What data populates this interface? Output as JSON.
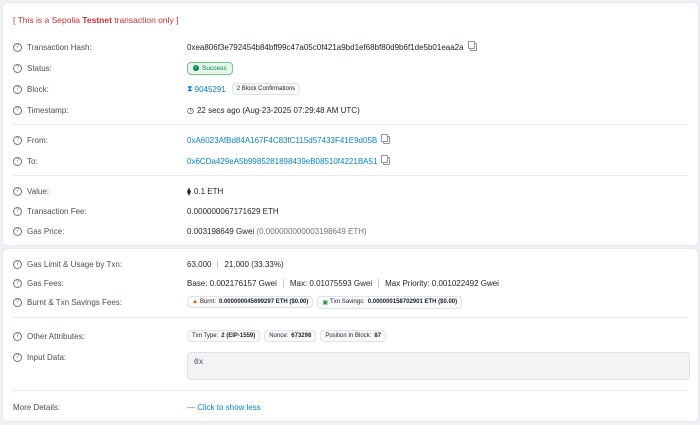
{
  "notice": {
    "prefix": "[ This is a Sepolia ",
    "bold": "Testnet",
    "suffix": " transaction only ]"
  },
  "overview": {
    "hash_label": "Transaction Hash:",
    "hash": "0xea806f3e792454b84bff99c47a05c0f421a9bd1ef68bf80d9b6f1de5b01eaa2a",
    "status_label": "Status:",
    "status": "Success",
    "block_label": "Block:",
    "block": "9045291",
    "confirmations": "2 Block Confirmations",
    "timestamp_label": "Timestamp:",
    "timestamp": "22 secs ago (Aug-23-2025 07:29:48 AM UTC)",
    "from_label": "From:",
    "from": "0xA6023AfBd84A167F4C83fC115d57433F41E9d05B",
    "to_label": "To:",
    "to": "0x6CDa429eA5b9985281898439eB08510f4221BA51",
    "value_label": "Value:",
    "value": "0.1 ETH",
    "fee_label": "Transaction Fee:",
    "fee": "0.000000067171629 ETH",
    "gasprice_label": "Gas Price:",
    "gasprice": "0.003198649 Gwei",
    "gasprice_eth": "(0.000000000003198649 ETH)"
  },
  "details": {
    "gaslimit_label": "Gas Limit & Usage by Txn:",
    "gas_limit": "63,000",
    "gas_used": "21,000 (33.33%)",
    "gasfees_label": "Gas Fees:",
    "base": "Base: 0.002176157 Gwei",
    "max": "Max: 0.01075593 Gwei",
    "max_priority": "Max Priority: 0.001022492 Gwei",
    "burnt_label": "Burnt & Txn Savings Fees:",
    "burnt_key": "Burnt:",
    "burnt_value": "0.000000045699297 ETH ($0.00)",
    "savings_key": "Txn Savings:",
    "savings_value": "0.000000158702901 ETH ($0.00)",
    "other_label": "Other Attributes:",
    "txn_type_key": "Txn Type:",
    "txn_type_value": "2 (EIP-1559)",
    "nonce_key": "Nonce:",
    "nonce_value": "673298",
    "position_key": "Position In Block:",
    "position_value": "87",
    "input_label": "Input Data:",
    "input_value": "0x",
    "more_label": "More Details:",
    "more_link": "— Click to show less"
  }
}
